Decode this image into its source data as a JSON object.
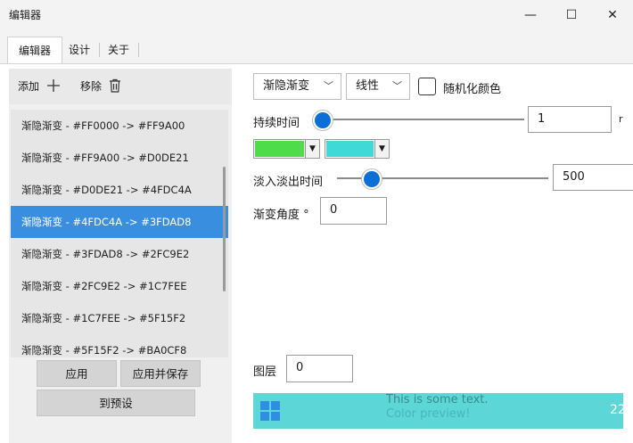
{
  "window": {
    "title": "编辑器",
    "minimize_glyph": "—",
    "maximize_glyph": "☐",
    "close_glyph": "✕"
  },
  "tabs": [
    {
      "label": "编辑器",
      "active": true
    },
    {
      "label": "设计"
    },
    {
      "label": "关于"
    }
  ],
  "toolbar": {
    "add_label": "添加",
    "remove_label": "移除"
  },
  "list": {
    "items": [
      "渐隐渐变 - #FF0000 -> #FF9A00",
      "渐隐渐变 - #FF9A00 -> #D0DE21",
      "渐隐渐变 - #D0DE21 -> #4FDC4A",
      "渐隐渐变 - #4FDC4A -> #3FDAD8",
      "渐隐渐变 - #3FDAD8 -> #2FC9E2",
      "渐隐渐变 - #2FC9E2 -> #1C7FEE",
      "渐隐渐变 - #1C7FEE -> #5F15F2",
      "渐隐渐变 - #5F15F2 -> #BA0CF8"
    ],
    "selected_index": 3
  },
  "buttons": {
    "apply": "应用",
    "apply_save": "应用并保存",
    "to_preset": "到预设"
  },
  "editor": {
    "effect_combo": "渐隐渐变",
    "mode_combo": "线性",
    "randomize_label": "随机化颜色",
    "randomize_checked": false,
    "duration_label": "持续时间",
    "duration_value": "1",
    "duration_unit_clip": "r",
    "duration_slider_fraction": 0.0,
    "color1": "#4FDC4A",
    "color2": "#3FDAD8",
    "fade_label": "淡入淡出时间",
    "fade_value": "500",
    "fade_slider_fraction": 0.13,
    "angle_label": "渐变角度 °",
    "angle_value": "0",
    "layer_label": "图层",
    "layer_value": "0"
  },
  "preview": {
    "background": "#5DD6D8",
    "line1": "This is some text.",
    "line2": "Color preview!",
    "clock_clip": "22"
  }
}
